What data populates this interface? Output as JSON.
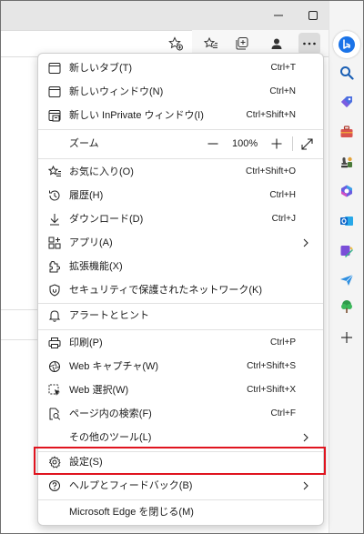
{
  "menu": {
    "items": [
      {
        "label": "新しいタブ(T)",
        "shortcut": "Ctrl+T"
      },
      {
        "label": "新しいウィンドウ(N)",
        "shortcut": "Ctrl+N"
      },
      {
        "label": "新しい InPrivate ウィンドウ(I)",
        "shortcut": "Ctrl+Shift+N"
      },
      {
        "label": "ズーム",
        "shortcut": ""
      },
      {
        "label": "お気に入り(O)",
        "shortcut": "Ctrl+Shift+O"
      },
      {
        "label": "履歴(H)",
        "shortcut": "Ctrl+H"
      },
      {
        "label": "ダウンロード(D)",
        "shortcut": "Ctrl+J"
      },
      {
        "label": "アプリ(A)",
        "shortcut": ""
      },
      {
        "label": "拡張機能(X)",
        "shortcut": ""
      },
      {
        "label": "セキュリティで保護されたネットワーク(K)",
        "shortcut": ""
      },
      {
        "label": "アラートとヒント",
        "shortcut": ""
      },
      {
        "label": "印刷(P)",
        "shortcut": "Ctrl+P"
      },
      {
        "label": "Web キャプチャ(W)",
        "shortcut": "Ctrl+Shift+S"
      },
      {
        "label": "Web 選択(W)",
        "shortcut": "Ctrl+Shift+X"
      },
      {
        "label": "ページ内の検索(F)",
        "shortcut": "Ctrl+F"
      },
      {
        "label": "その他のツール(L)",
        "shortcut": ""
      },
      {
        "label": "設定(S)",
        "shortcut": ""
      },
      {
        "label": "ヘルプとフィードバック(B)",
        "shortcut": ""
      },
      {
        "label": "Microsoft Edge を閉じる(M)",
        "shortcut": ""
      }
    ],
    "zoom": {
      "value": "100%",
      "minus": "−",
      "plus": "+"
    }
  },
  "colors": {
    "highlight_border": "#e0141f",
    "titlebar_bg": "#e6e6e6",
    "sidebar_bg": "#f4f4f4",
    "bing_blue": "#1a73e8"
  },
  "icons": {
    "window": [
      "minimize-icon",
      "maximize-icon",
      "close-icon"
    ],
    "toolbar": [
      "add-favorite-icon",
      "favorites-icon",
      "collections-icon",
      "profile-icon",
      "more-icon"
    ],
    "sidebar": [
      "bing-copilot-icon",
      "search-icon",
      "shopping-icon",
      "tools-icon",
      "games-icon",
      "microsoft365-icon",
      "outlook-icon",
      "designer-icon",
      "send-icon",
      "tree-icon",
      "add-icon"
    ]
  }
}
